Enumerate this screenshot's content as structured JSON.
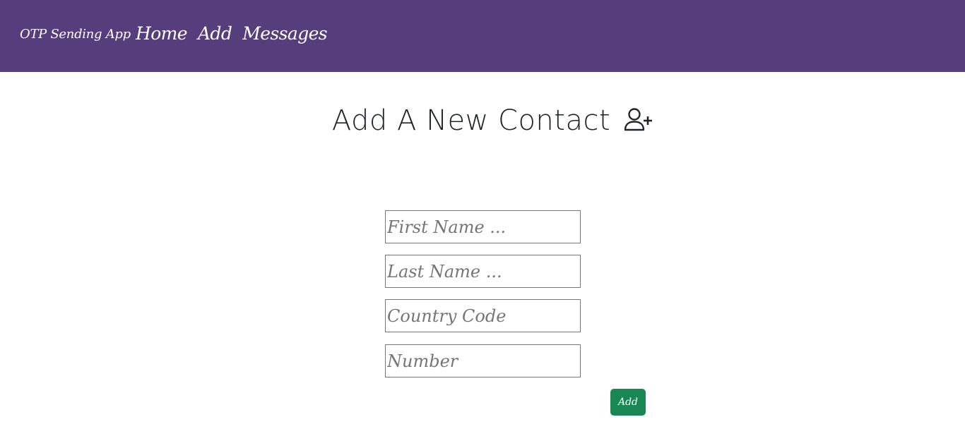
{
  "navbar": {
    "brand": "OTP Sending App",
    "links": [
      {
        "label": "Home"
      },
      {
        "label": "Add"
      },
      {
        "label": "Messages"
      }
    ],
    "background_color": "#563d7c"
  },
  "main": {
    "title": "Add A New Contact",
    "title_icon": "user-plus-icon"
  },
  "form": {
    "first_name": {
      "value": "",
      "placeholder": "First Name ..."
    },
    "last_name": {
      "value": "",
      "placeholder": "Last Name ..."
    },
    "country_code": {
      "value": "",
      "placeholder": "Country Code"
    },
    "number": {
      "value": "",
      "placeholder": "Number"
    },
    "submit_label": "Add",
    "submit_color": "#198754"
  }
}
